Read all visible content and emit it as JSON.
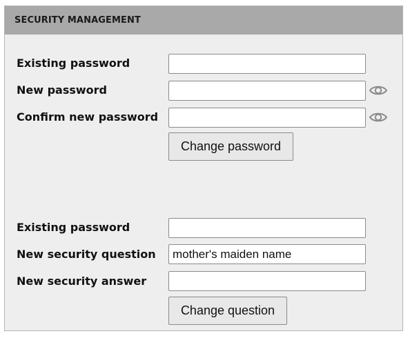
{
  "panel": {
    "title": "SECURITY MANAGEMENT"
  },
  "password_form": {
    "existing_label": "Existing password",
    "existing_value": "",
    "new_label": "New password",
    "new_value": "",
    "confirm_label": "Confirm new password",
    "confirm_value": "",
    "submit_label": "Change password",
    "reveal_icon": "eye-icon"
  },
  "question_form": {
    "existing_label": "Existing password",
    "existing_value": "",
    "question_label": "New security question",
    "question_value": "mother's maiden name",
    "answer_label": "New security answer",
    "answer_value": "",
    "submit_label": "Change question"
  },
  "colors": {
    "header_bg": "#a9a9a9",
    "panel_bg": "#eeeeee",
    "icon": "#8c8c8c"
  }
}
